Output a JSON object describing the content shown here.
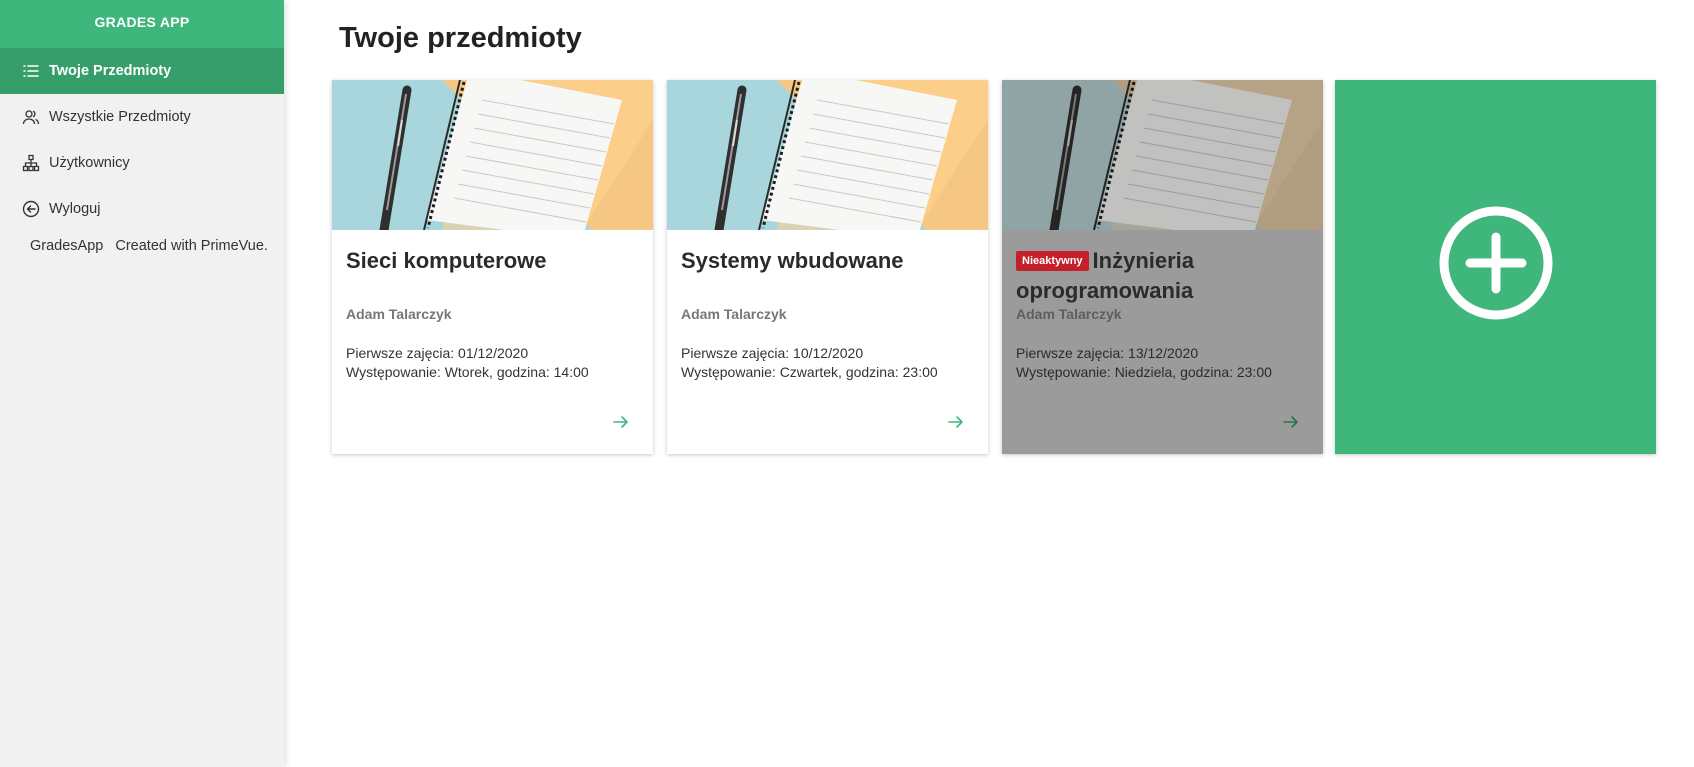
{
  "app": {
    "brand": "GRADES APP"
  },
  "sidebar": {
    "items": [
      {
        "label": "Twoje Przedmioty",
        "icon": "list-icon",
        "active": true
      },
      {
        "label": "Wszystkie Przedmioty",
        "icon": "users-icon",
        "active": false
      },
      {
        "label": "Użytkownicy",
        "icon": "sitemap-icon",
        "active": false
      },
      {
        "label": "Wyloguj",
        "icon": "arrow-circle-left-icon",
        "active": false
      }
    ],
    "footer": {
      "app_name": "GradesApp",
      "credit": "Created with PrimeVue."
    }
  },
  "main": {
    "title": "Twoje przedmioty",
    "cards": [
      {
        "title": "Sieci komputerowe",
        "teacher": "Adam Talarczyk",
        "first_class": "Pierwsze zajęcia: 01/12/2020",
        "occurrence": "Występowanie: Wtorek, godzina: 14:00",
        "badge": "",
        "active": true
      },
      {
        "title": "Systemy wbudowane",
        "teacher": "Adam Talarczyk",
        "first_class": "Pierwsze zajęcia: 10/12/2020",
        "occurrence": "Występowanie: Czwartek, godzina: 23:00",
        "badge": "",
        "active": true
      },
      {
        "title": "Inżynieria oprogramowania",
        "teacher": "Adam Talarczyk",
        "first_class": "Pierwsze zajęcia: 13/12/2020",
        "occurrence": "Występowanie: Niedziela, godzina: 23:00",
        "badge": "Nieaktywny",
        "active": false
      }
    ],
    "add_card": {
      "icon": "plus-circle-icon"
    }
  },
  "colors": {
    "accent": "#3eb67c",
    "accent_dark": "#369e6a",
    "sidebar_bg": "#f1f1f1",
    "badge_red": "#c3202c",
    "inactive_card": "#9b9b9b"
  }
}
